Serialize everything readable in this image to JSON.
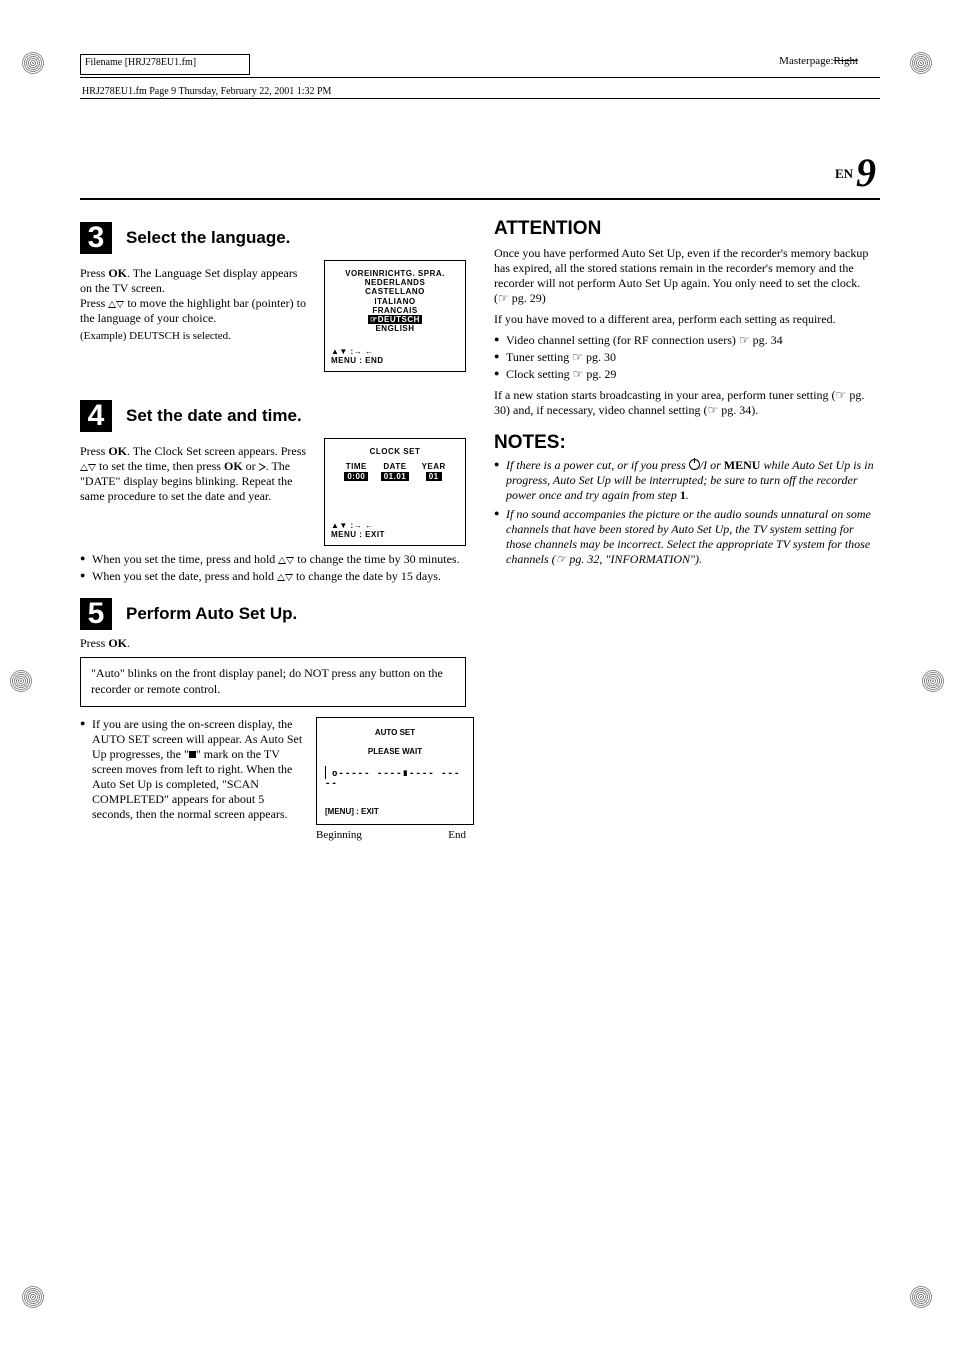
{
  "header": {
    "filename_label": "Filename [HRJ278EU1.fm]",
    "pagemaker_line": "HRJ278EU1.fm  Page 9  Thursday, February 22, 2001  1:32 PM",
    "masterpage_label": "Masterpage:",
    "masterpage_value": "Right"
  },
  "page_number": {
    "lang": "EN",
    "num": "9"
  },
  "left": {
    "step3": {
      "num": "3",
      "title": "Select the language.",
      "p1a": "Press ",
      "p1b": ". The Language Set display appears on the TV screen.",
      "p2a": "Press ",
      "p2b": " to move the highlight bar (pointer) to the language of your choice.",
      "example": "(Example) DEUTSCH is selected.",
      "screen": {
        "title": "VOREINRICHTG. SPRA.",
        "items": [
          "NEDERLANDS",
          "CASTELLANO",
          "ITALIANO",
          "FRANCAIS"
        ],
        "selected": "☞DEUTSCH",
        "last": "ENGLISH",
        "nav1": "▲▼ :→ ←",
        "nav2": "MENU :  END"
      }
    },
    "step4": {
      "num": "4",
      "title": "Set the date and time.",
      "p1a": "Press ",
      "p1b": ". The Clock Set screen appears. Press ",
      "p1c": " to set the time, then press ",
      "p1d": " or ",
      "p1e": ". The \"DATE\" display begins blinking. Repeat the same procedure to set the date and year.",
      "screen": {
        "title": "CLOCK SET",
        "cols": [
          {
            "label": "TIME",
            "value": "0:00"
          },
          {
            "label": "DATE",
            "value": "01.01"
          },
          {
            "label": "YEAR",
            "value": "01"
          }
        ],
        "nav1": "▲▼ :→ ←",
        "nav2": "MENU :  EXIT"
      },
      "bul1a": "When you set the time,  press and hold ",
      "bul1b": " to change the time by 30 minutes.",
      "bul2a": "When you set the date,  press and hold ",
      "bul2b": " to change the date by 15 days."
    },
    "step5": {
      "num": "5",
      "title": "Perform Auto Set Up.",
      "press_ok": "Press ",
      "box": "\"Auto\" blinks on the front display panel; do NOT press any button on the recorder or remote control.",
      "para": "If you are using the on-screen display, the AUTO SET screen will appear. As Auto Set Up progresses, the \"",
      "para2": "\" mark on the TV screen moves from left to right. When the Auto Set Up is completed, \"SCAN COMPLETED\" appears for about 5 seconds, then the normal screen appears.",
      "screen": {
        "title": "AUTO SET",
        "line": "PLEASE  WAIT",
        "progress": "o----- ----∎---- -----",
        "menu": "[MENU] : EXIT",
        "begin": "Beginning",
        "end": "End"
      }
    },
    "ok": "OK"
  },
  "right": {
    "attention": {
      "title": "ATTENTION",
      "p1": "Once you have performed Auto Set Up, even if the recorder's memory backup has expired, all the stored stations remain in the recorder's memory and the recorder will not perform Auto Set Up again. You only need to set the clock.",
      "p1_ref": "(☞ pg. 29)",
      "p2": "If you have moved to a different area, perform each setting as required.",
      "b1": "Video channel setting (for RF connection users) ☞ pg. 34",
      "b2": "Tuner setting ☞ pg. 30",
      "b3": "Clock setting ☞ pg. 29",
      "p3": "If a new station starts broadcasting in your area, perform tuner setting (☞ pg. 30) and, if necessary, video channel setting  (☞ pg. 34)."
    },
    "notes": {
      "title": "NOTES:",
      "n1a": "If there is a power cut, or if you press ",
      "n1b": " or ",
      "n1c": " while Auto Set Up is in progress, Auto Set Up will be interrupted; be sure to turn off the recorder power once and try again from step ",
      "n1d": ".",
      "n1_menu": "MENU",
      "n1_step": "1",
      "n2": "If no sound accompanies the picture or the audio sounds unnatural on some channels that have been stored by Auto Set Up, the TV system setting for those channels may be incorrect. Select the appropriate TV system for those channels (☞ pg. 32, \"INFORMATION\")."
    }
  }
}
